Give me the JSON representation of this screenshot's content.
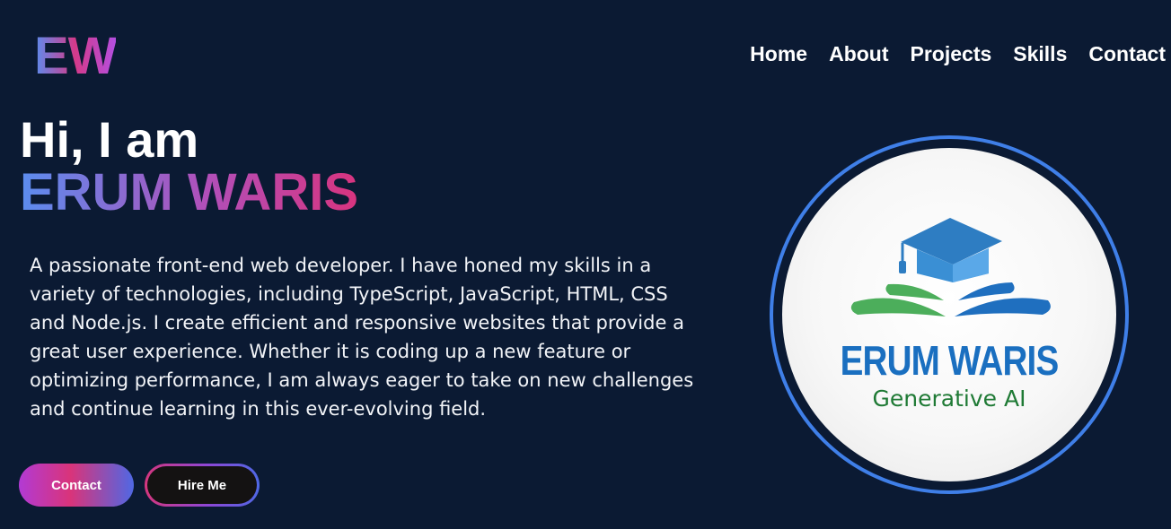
{
  "logo": {
    "text": "EW"
  },
  "nav": {
    "items": [
      {
        "label": "Home"
      },
      {
        "label": "About"
      },
      {
        "label": "Projects"
      },
      {
        "label": "Skills"
      },
      {
        "label": "Contact"
      }
    ]
  },
  "hero": {
    "greeting": "Hi, I am",
    "name": "ERUM WARIS",
    "bio": "A passionate front-end web developer. I have honed my skills in a variety of technologies, including TypeScript, JavaScript, HTML, CSS and Node.js. I create efficient and responsive websites that provide a great user experience. Whether it is coding up a new feature or optimizing performance, I am always eager to take on new challenges and continue learning in this ever-evolving field.",
    "buttons": {
      "contact": "Contact",
      "hire": "Hire Me"
    }
  },
  "profile_image": {
    "title": "ERUM WARIS",
    "subtitle": "Generative AI",
    "icon": "graduation-cap-book-icon"
  },
  "colors": {
    "background": "#0b1a33",
    "ring": "#3f7fe8",
    "gradient_pink": "#d8347f",
    "gradient_blue": "#5b8def",
    "gradient_purple": "#b44fe0",
    "logo_text_blue": "#1a6fc0",
    "logo_text_green": "#1f7a35"
  }
}
